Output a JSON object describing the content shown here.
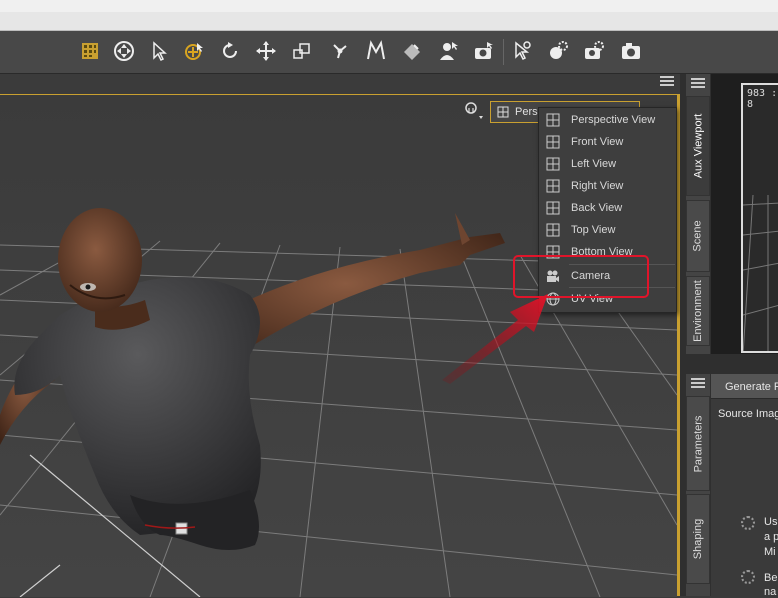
{
  "toolbar": {
    "icons": [
      "grid-tool-icon",
      "universal-tool-icon",
      "pointer-tool-icon",
      "node-select-icon",
      "rotate-tool-icon",
      "translate-tool-icon",
      "scale-tool-icon",
      "joint-editor-icon",
      "geometry-editor-icon",
      "surface-selection-icon",
      "figure-select-icon",
      "render-icon",
      "camera-pointer-icon",
      "spot-render-icon",
      "render-settings-icon",
      "camera-icon"
    ]
  },
  "viewport": {
    "camera_selector_label": "Persp"
  },
  "camera_menu": {
    "items": [
      {
        "label": "Perspective View",
        "icon": "view-grid-icon"
      },
      {
        "label": "Front View",
        "icon": "view-grid-icon"
      },
      {
        "label": "Left View",
        "icon": "view-grid-icon"
      },
      {
        "label": "Right View",
        "icon": "view-grid-icon"
      },
      {
        "label": "Back View",
        "icon": "view-grid-icon"
      },
      {
        "label": "Top View",
        "icon": "view-grid-icon"
      },
      {
        "label": "Bottom View",
        "icon": "view-grid-icon"
      },
      {
        "label": "Camera",
        "icon": "camera-icon"
      },
      {
        "label": "UV View",
        "icon": "globe-icon"
      }
    ]
  },
  "right_tabs": {
    "upper": [
      "Aux Viewport",
      "Scene",
      "Environment"
    ],
    "lower": [
      "Parameters",
      "Shaping"
    ]
  },
  "aux_viewport": {
    "label": "983 : 8"
  },
  "lower_pane": {
    "header": "Generate F",
    "source_label": "Source Imag",
    "lines1": [
      "Us",
      "a p",
      "Mi"
    ],
    "lines2": [
      "Be",
      "na"
    ]
  },
  "colors": {
    "accent": "#c9a030",
    "highlight": "#e0142a"
  }
}
